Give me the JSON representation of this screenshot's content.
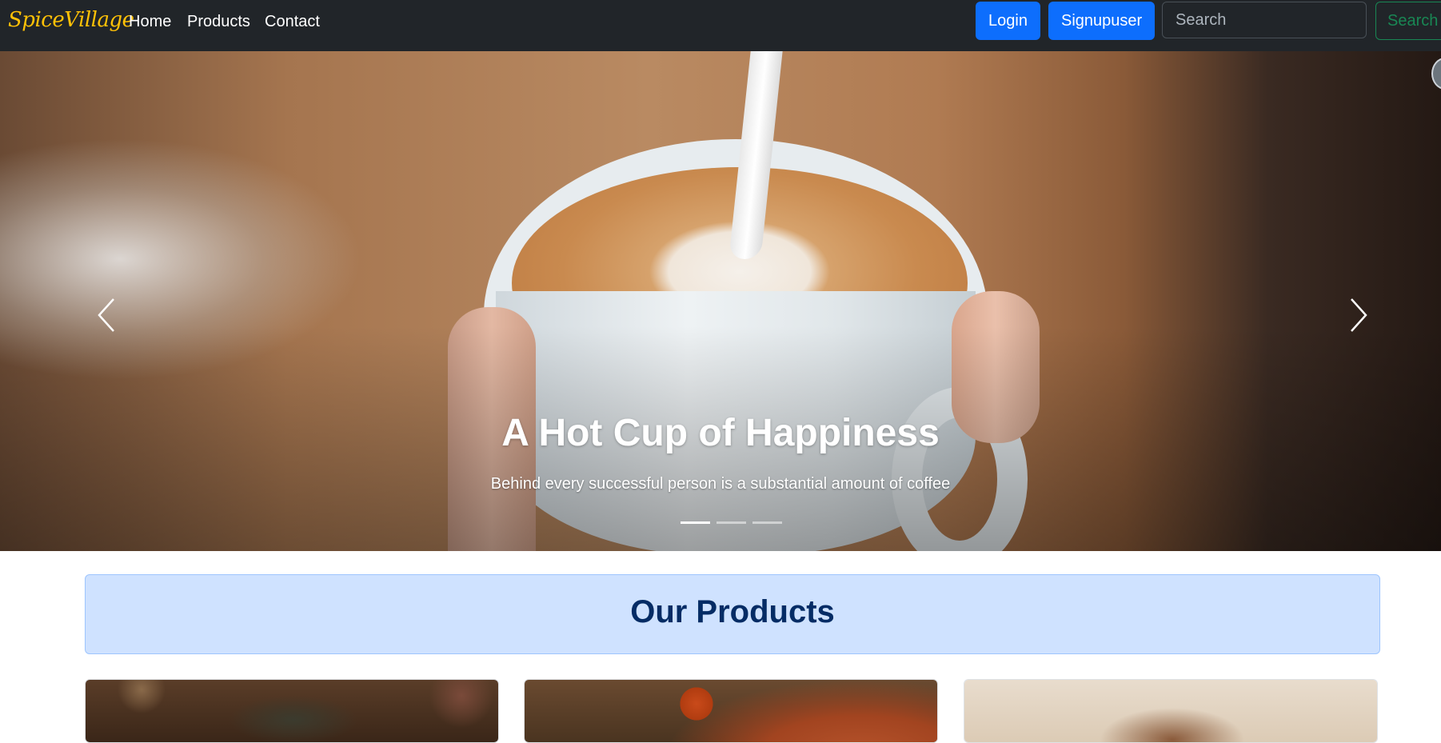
{
  "navbar": {
    "brand": "SpiceVillage",
    "links": [
      "Home",
      "Products",
      "Contact"
    ],
    "login_label": "Login",
    "signup_label": "Signupuser",
    "search_placeholder": "Search",
    "search_button_label": "Search"
  },
  "carousel": {
    "caption_title": "A Hot Cup of Happiness",
    "caption_text": "Behind every successful person is a substantial amount of coffee",
    "slide_count": 3,
    "active_slide": 1,
    "prev_icon": "chevron-left-icon",
    "next_icon": "chevron-right-icon"
  },
  "products": {
    "title": "Our Products"
  },
  "colors": {
    "navbar_bg": "#212529",
    "brand": "#ffc107",
    "primary": "#0d6efd",
    "success": "#198754",
    "banner_bg": "#cfe2ff",
    "banner_text": "#052c65"
  }
}
